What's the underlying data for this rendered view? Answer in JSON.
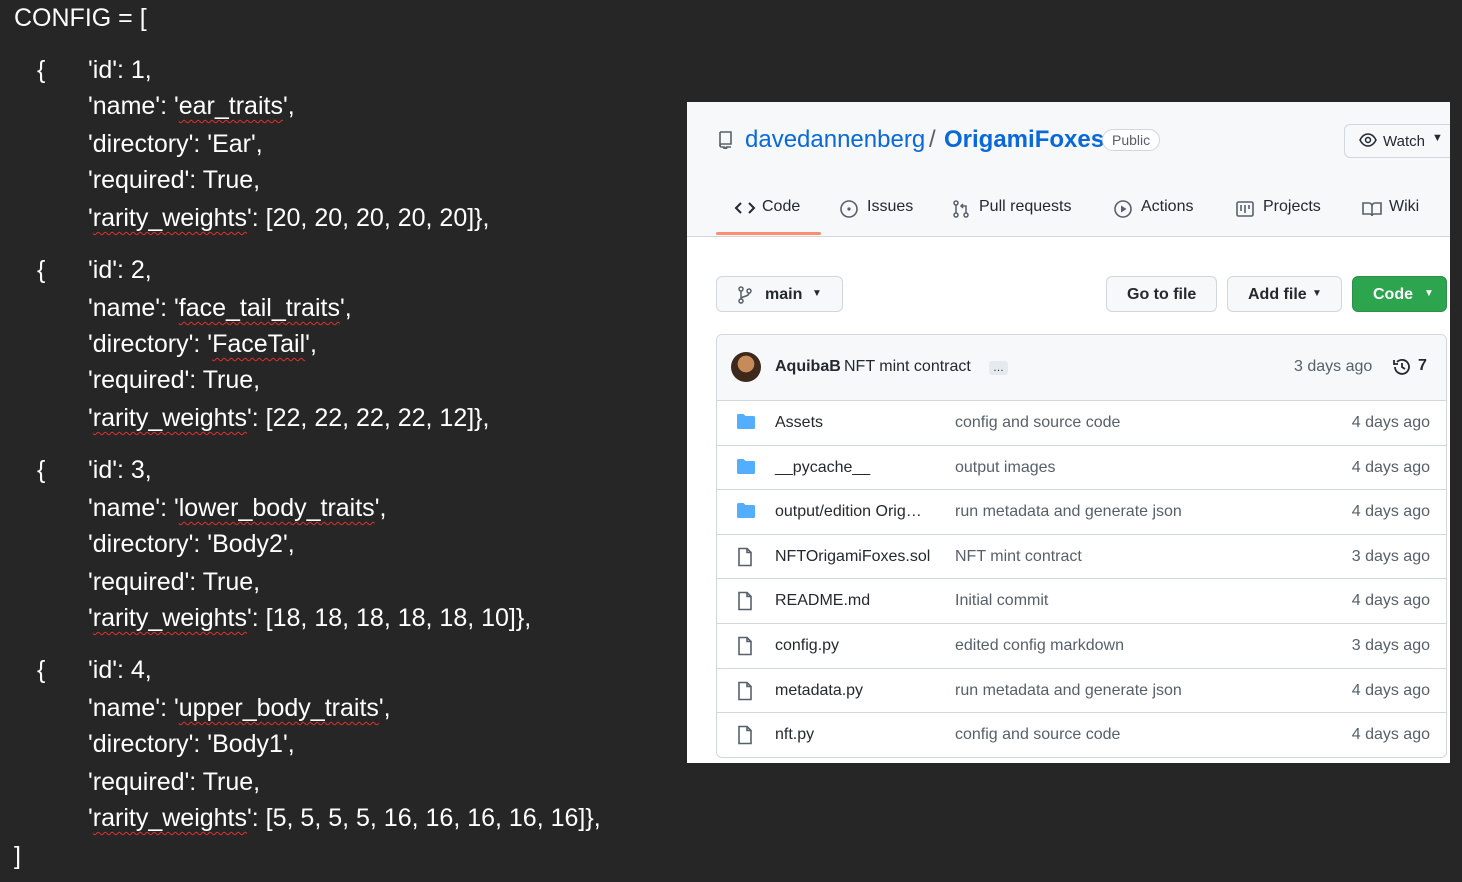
{
  "code": {
    "header": "CONFIG = [",
    "closing": "]",
    "entries": [
      {
        "id_line": "'id': 1,",
        "name_key": "'name': '",
        "name_val": "ear_traits",
        "name_end": "',",
        "dir_line": "'directory': 'Ear',",
        "dir_sq": "",
        "req_line": "'required': True,",
        "rw_key": "rarity_weights",
        "rw_val": "': [20, 20, 20, 20, 20]},"
      },
      {
        "id_line": "'id': 2,",
        "name_key": "'name': '",
        "name_val": "face_tail_traits",
        "name_end": "',",
        "dir_line": "'directory': '",
        "dir_sq": "FaceTail",
        "dir_end": "',",
        "req_line": "'required': True,",
        "rw_key": "rarity_weights",
        "rw_val": "': [22, 22, 22, 22, 12]},"
      },
      {
        "id_line": "'id': 3,",
        "name_key": "'name': '",
        "name_val": "lower_body_traits",
        "name_end": "',",
        "dir_line": "'directory': 'Body2',",
        "dir_sq": "",
        "req_line": "'required': True,",
        "rw_key": "rarity_weights",
        "rw_val": "': [18, 18, 18, 18, 18, 10]},"
      },
      {
        "id_line": "'id': 4,",
        "name_key": "'name': '",
        "name_val": "upper_body_traits",
        "name_end": "',",
        "dir_line": "'directory': 'Body1',",
        "dir_sq": "",
        "req_line": "'required': True,",
        "rw_key": "rarity_weights",
        "rw_val": "': [5, 5, 5, 5, 16, 16, 16, 16, 16]},"
      }
    ]
  },
  "github": {
    "owner": "davedannenberg",
    "separator": "/",
    "repo": "OrigamiFoxes",
    "visibility": "Public",
    "watch_label": "Watch",
    "tabs": {
      "code": "Code",
      "issues": "Issues",
      "pulls": "Pull requests",
      "actions": "Actions",
      "projects": "Projects",
      "wiki": "Wiki"
    },
    "branch": "main",
    "go_to_file": "Go to file",
    "add_file": "Add file",
    "code_button": "Code",
    "commit": {
      "author": "AquibaB",
      "message": "NFT mint contract",
      "dots": "…",
      "time": "3 days ago",
      "count": "7"
    },
    "files": [
      {
        "name": "Assets",
        "message": "config and source code",
        "age": "4 days ago",
        "type": "folder"
      },
      {
        "name": "__pycache__",
        "message": "output images",
        "age": "4 days ago",
        "type": "folder"
      },
      {
        "name": "output/edition Orig…",
        "message": "run metadata and generate json",
        "age": "4 days ago",
        "type": "folder"
      },
      {
        "name": "NFTOrigamiFoxes.sol",
        "message": "NFT mint contract",
        "age": "3 days ago",
        "type": "file"
      },
      {
        "name": "README.md",
        "message": "Initial commit",
        "age": "4 days ago",
        "type": "file"
      },
      {
        "name": "config.py",
        "message": "edited config markdown",
        "age": "3 days ago",
        "type": "file"
      },
      {
        "name": "metadata.py",
        "message": "run metadata and generate json",
        "age": "4 days ago",
        "type": "file"
      },
      {
        "name": "nft.py",
        "message": "config and source code",
        "age": "4 days ago",
        "type": "file"
      }
    ],
    "colors": {
      "link": "#0969da",
      "code_button": "#2da44e",
      "tab_underline": "#fd8c73",
      "folder": "#54aeff"
    }
  }
}
